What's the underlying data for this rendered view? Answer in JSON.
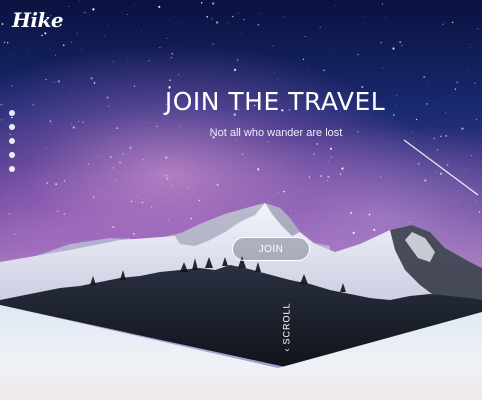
{
  "brand": {
    "logo_text": "Hike"
  },
  "nav_dots": {
    "count": 5
  },
  "hero": {
    "title": "JOIN THE TRAVEL",
    "subtitle": "Not all who wander are lost",
    "join_label": "JOIN"
  },
  "scroll": {
    "label": "SCROLL",
    "arrow_icon": "chevron-left-icon"
  },
  "colors": {
    "text": "#ffffff",
    "sky_top": "#0a1240",
    "sky_glow": "#c69ad0",
    "snow": "#e9eef5",
    "forest": "#141a22"
  }
}
